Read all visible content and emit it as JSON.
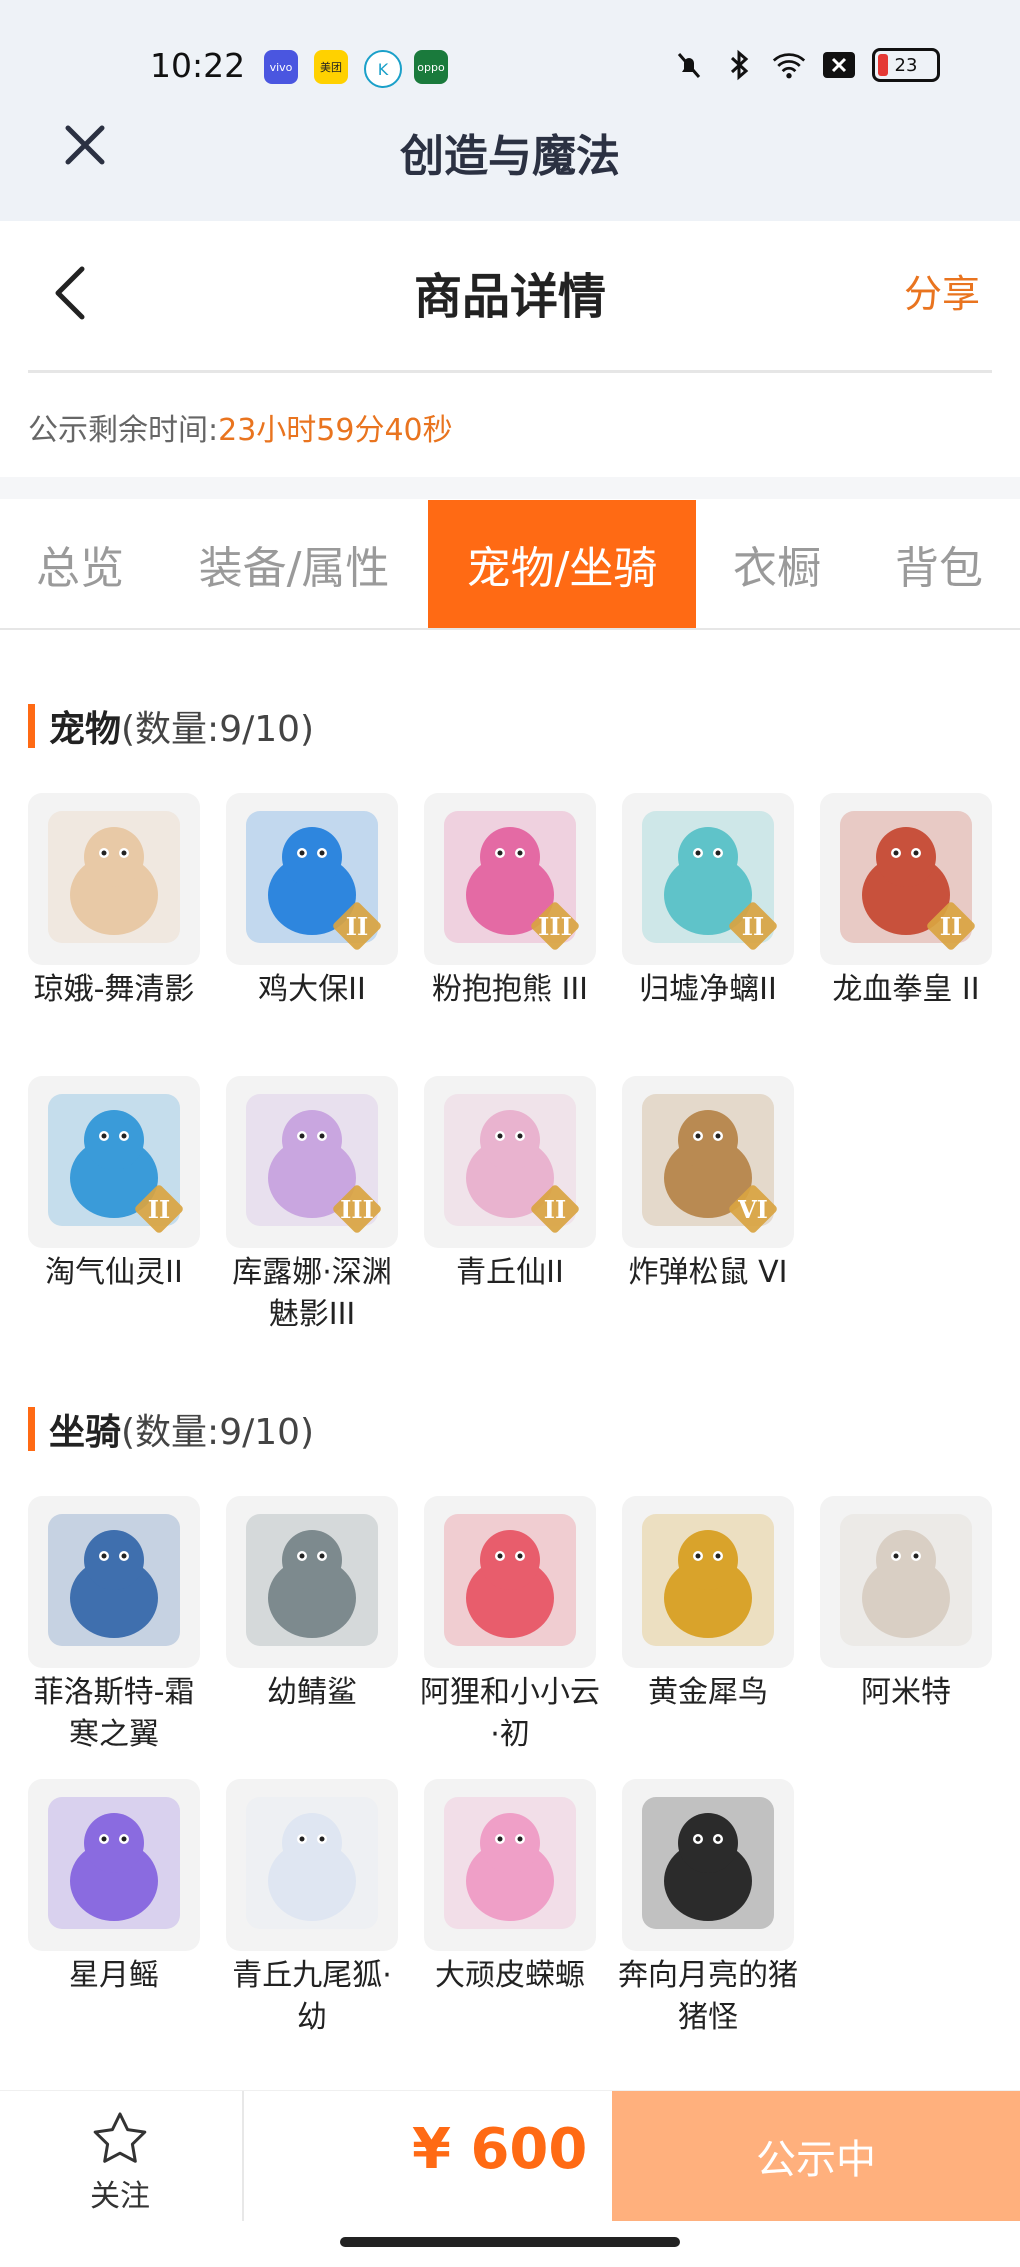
{
  "status_bar": {
    "time": "10:22",
    "battery": "23",
    "notif_apps": [
      {
        "name": "vivo",
        "color": "#4a56e0"
      },
      {
        "name": "美团",
        "color": "#ffd100"
      },
      {
        "name": "K",
        "color": "#ffffff"
      },
      {
        "name": "oppo",
        "color": "#1a7a3c"
      }
    ]
  },
  "app": {
    "title": "创造与魔法"
  },
  "header": {
    "title": "商品详情",
    "share": "分享"
  },
  "timer": {
    "label": "公示剩余时间:",
    "value": "23小时59分40秒"
  },
  "tabs": [
    {
      "label": "总览"
    },
    {
      "label": "装备/属性"
    },
    {
      "label": "宠物/坐骑",
      "active": true
    },
    {
      "label": "衣橱"
    },
    {
      "label": "背包"
    }
  ],
  "pets": {
    "title": "宠物",
    "count": "(数量:9/10)",
    "items": [
      {
        "name": "琼娥-舞清影",
        "tier": "",
        "color": "#e8c9a6"
      },
      {
        "name": "鸡大保II",
        "tier": "II",
        "color": "#2e86de"
      },
      {
        "name": "粉抱抱熊 III",
        "tier": "III",
        "color": "#e46aa4"
      },
      {
        "name": "归墟净螭II",
        "tier": "II",
        "color": "#5fc3c9"
      },
      {
        "name": "龙血拳皇 II",
        "tier": "II",
        "color": "#c8513c"
      },
      {
        "name": "淘气仙灵II",
        "tier": "II",
        "color": "#3a9bd9"
      },
      {
        "name": "库露娜·深渊魅影III",
        "tier": "III",
        "color": "#c9a6e0"
      },
      {
        "name": "青丘仙II",
        "tier": "II",
        "color": "#e9b3cf"
      },
      {
        "name": "炸弹松鼠 VI",
        "tier": "VI",
        "color": "#b98a52"
      }
    ]
  },
  "mounts": {
    "title": "坐骑",
    "count": "(数量:9/10)",
    "items": [
      {
        "name": "菲洛斯特-霜寒之翼",
        "color": "#3f6fae"
      },
      {
        "name": "幼鲭鲨",
        "color": "#7d8a8e"
      },
      {
        "name": "阿狸和小小云·初",
        "color": "#e85d6c"
      },
      {
        "name": "黄金犀鸟",
        "color": "#d9a32b"
      },
      {
        "name": "阿米特",
        "color": "#d9cfc4"
      },
      {
        "name": "星月鳐",
        "color": "#8a6be0"
      },
      {
        "name": "青丘九尾狐·幼",
        "color": "#dfe6f2"
      },
      {
        "name": "大顽皮蝾螈",
        "color": "#ef9fc7"
      },
      {
        "name": "奔向月亮的猪猪怪",
        "color": "#2b2b2b"
      }
    ]
  },
  "bottom": {
    "follow": "关注",
    "price": "¥ 600",
    "status": "公示中"
  },
  "colors": {
    "accent": "#ff6a14",
    "accent_light": "#ffb07d",
    "orange_text": "#e9741f"
  }
}
